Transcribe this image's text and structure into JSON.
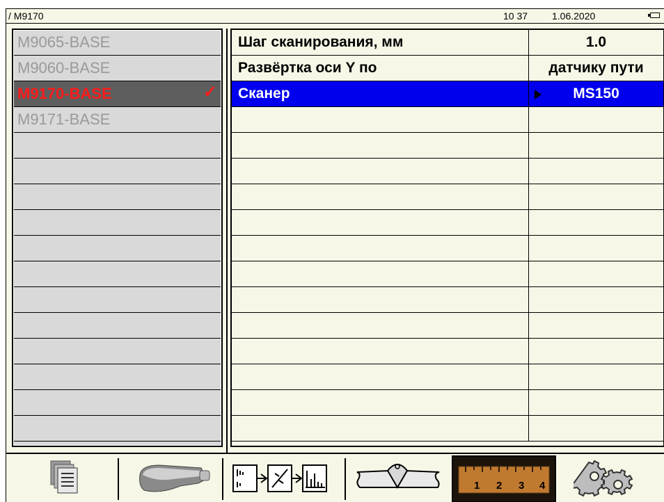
{
  "status": {
    "title": "/ M9170",
    "time": "10 37",
    "date": "1.06.2020"
  },
  "bases": [
    {
      "label": "M9065-BASE",
      "selected": false
    },
    {
      "label": "M9060-BASE",
      "selected": false
    },
    {
      "label": "M9170-BASE",
      "selected": true
    },
    {
      "label": "M9171-BASE",
      "selected": false
    }
  ],
  "checkmark": "✓",
  "params": [
    {
      "name": "Шаг сканирования, мм",
      "value": "1.0"
    },
    {
      "name": "Развёртка оси Y по",
      "value": "датчику пути"
    },
    {
      "name": "Сканер",
      "value": "MS150",
      "active": true
    }
  ],
  "ruler_numbers": [
    "1",
    "2",
    "3",
    "4"
  ],
  "toolbar": [
    "documents-icon",
    "probe-icon",
    "signal-processing-icon",
    "weld-joint-icon",
    "ruler-icon",
    "settings-gears-icon"
  ]
}
